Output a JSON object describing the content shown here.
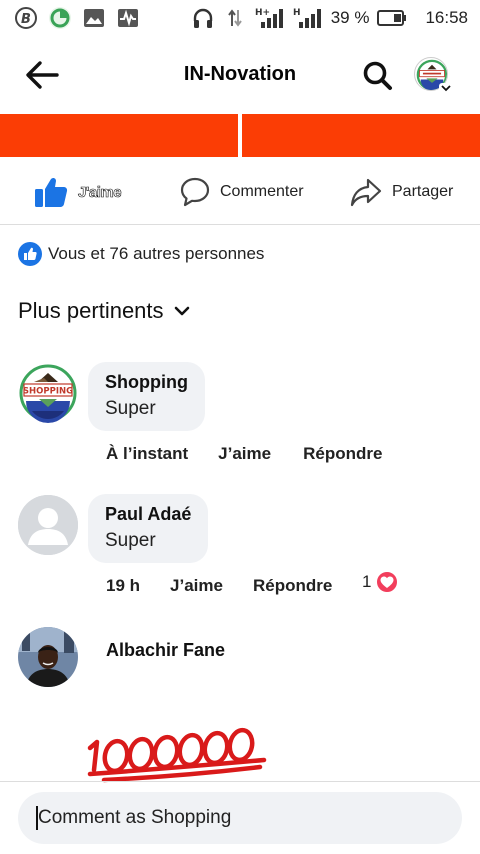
{
  "status_bar": {
    "battery_percent": "39 %",
    "time": "16:58",
    "network_labels": [
      "H+",
      "H"
    ],
    "icons": [
      "b-app-icon",
      "circle-app-icon",
      "image-icon",
      "activity-icon",
      "headphones-icon",
      "data-arrows-icon",
      "signal-icon",
      "signal-icon",
      "battery-icon"
    ]
  },
  "header": {
    "title": "IN-Novation",
    "back_icon": "arrow-left-icon",
    "search_icon": "search-icon",
    "profile_icon": "profile-avatar"
  },
  "banner": {
    "color": "#fb3d05"
  },
  "actions": {
    "like": "J'aime",
    "comment": "Commenter",
    "share": "Partager"
  },
  "reactions": {
    "summary": "Vous et 76 autres personnes"
  },
  "sort": {
    "label": "Plus pertinents"
  },
  "comments": [
    {
      "author": "Shopping",
      "text": "Super",
      "time": "À l’instant",
      "like": "J’aime",
      "reply": "Répondre",
      "avatar": "shopping-logo"
    },
    {
      "author": "Paul Adaé",
      "text": "Super",
      "time": "19 h",
      "like": "J’aime",
      "reply": "Répondre",
      "reaction_count": "1",
      "reaction_icon": "heart-icon",
      "avatar": "default-avatar"
    },
    {
      "author": "Albachir Fane",
      "avatar": "photo-avatar",
      "image_text": "1000000"
    }
  ],
  "composer": {
    "placeholder": "Comment as Shopping"
  },
  "colors": {
    "accent_blue": "#1b74e4",
    "heart_red": "#f23e5c",
    "bubble_gray": "#f0f2f5",
    "handwrite_red": "#d91a1a"
  }
}
